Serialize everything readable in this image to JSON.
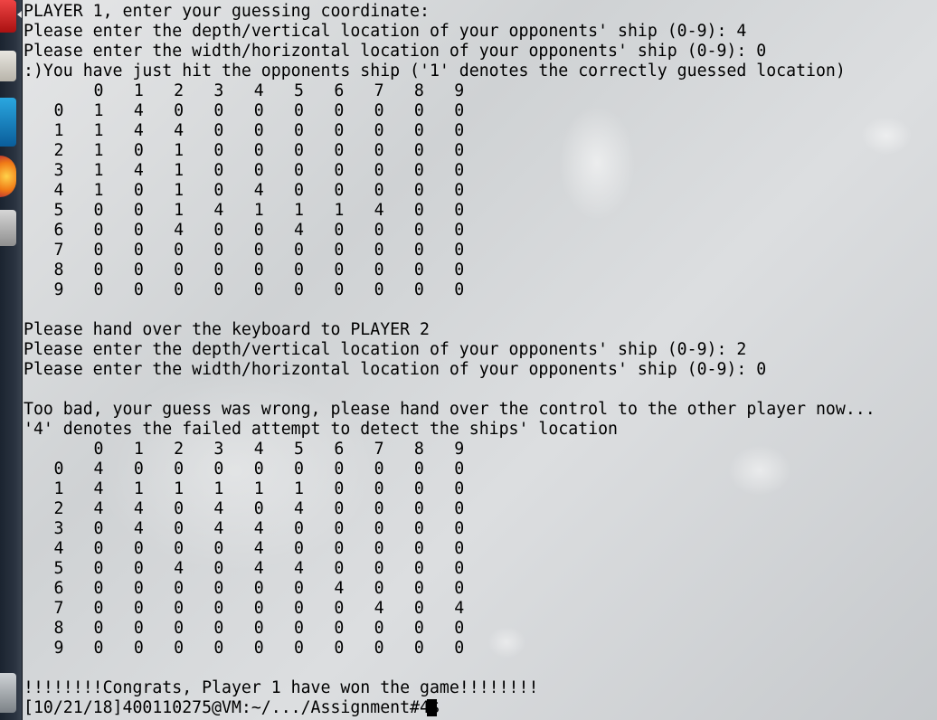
{
  "terminal": {
    "header_lines": [
      "PLAYER 1, enter your guessing coordinate:",
      "Please enter the depth/vertical location of your opponents' ship (0-9): 4",
      "Please enter the width/horizontal location of your opponents' ship (0-9): 0",
      ":)You have just hit the opponents ship ('1' denotes the correctly guessed location)"
    ],
    "grid1": {
      "col_headers": [
        "0",
        "1",
        "2",
        "3",
        "4",
        "5",
        "6",
        "7",
        "8",
        "9"
      ],
      "rows": [
        {
          "label": "0",
          "cells": [
            "1",
            "4",
            "0",
            "0",
            "0",
            "0",
            "0",
            "0",
            "0",
            "0"
          ]
        },
        {
          "label": "1",
          "cells": [
            "1",
            "4",
            "4",
            "0",
            "0",
            "0",
            "0",
            "0",
            "0",
            "0"
          ]
        },
        {
          "label": "2",
          "cells": [
            "1",
            "0",
            "1",
            "0",
            "0",
            "0",
            "0",
            "0",
            "0",
            "0"
          ]
        },
        {
          "label": "3",
          "cells": [
            "1",
            "4",
            "1",
            "0",
            "0",
            "0",
            "0",
            "0",
            "0",
            "0"
          ]
        },
        {
          "label": "4",
          "cells": [
            "1",
            "0",
            "1",
            "0",
            "4",
            "0",
            "0",
            "0",
            "0",
            "0"
          ]
        },
        {
          "label": "5",
          "cells": [
            "0",
            "0",
            "1",
            "4",
            "1",
            "1",
            "1",
            "4",
            "0",
            "0"
          ]
        },
        {
          "label": "6",
          "cells": [
            "0",
            "0",
            "4",
            "0",
            "0",
            "4",
            "0",
            "0",
            "0",
            "0"
          ]
        },
        {
          "label": "7",
          "cells": [
            "0",
            "0",
            "0",
            "0",
            "0",
            "0",
            "0",
            "0",
            "0",
            "0"
          ]
        },
        {
          "label": "8",
          "cells": [
            "0",
            "0",
            "0",
            "0",
            "0",
            "0",
            "0",
            "0",
            "0",
            "0"
          ]
        },
        {
          "label": "9",
          "cells": [
            "0",
            "0",
            "0",
            "0",
            "0",
            "0",
            "0",
            "0",
            "0",
            "0"
          ]
        }
      ]
    },
    "middle_lines": [
      "Please hand over the keyboard to PLAYER 2",
      "Please enter the depth/vertical location of your opponents' ship (0-9): 2",
      "Please enter the width/horizontal location of your opponents' ship (0-9): 0"
    ],
    "fail_lines": [
      "Too bad, your guess was wrong, please hand over the control to the other player now...",
      "'4' denotes the failed attempt to detect the ships' location"
    ],
    "grid2": {
      "col_headers": [
        "0",
        "1",
        "2",
        "3",
        "4",
        "5",
        "6",
        "7",
        "8",
        "9"
      ],
      "rows": [
        {
          "label": "0",
          "cells": [
            "4",
            "0",
            "0",
            "0",
            "0",
            "0",
            "0",
            "0",
            "0",
            "0"
          ]
        },
        {
          "label": "1",
          "cells": [
            "4",
            "1",
            "1",
            "1",
            "1",
            "1",
            "0",
            "0",
            "0",
            "0"
          ]
        },
        {
          "label": "2",
          "cells": [
            "4",
            "4",
            "0",
            "4",
            "0",
            "4",
            "0",
            "0",
            "0",
            "0"
          ]
        },
        {
          "label": "3",
          "cells": [
            "0",
            "4",
            "0",
            "4",
            "4",
            "0",
            "0",
            "0",
            "0",
            "0"
          ]
        },
        {
          "label": "4",
          "cells": [
            "0",
            "0",
            "0",
            "0",
            "4",
            "0",
            "0",
            "0",
            "0",
            "0"
          ]
        },
        {
          "label": "5",
          "cells": [
            "0",
            "0",
            "4",
            "0",
            "4",
            "4",
            "0",
            "0",
            "0",
            "0"
          ]
        },
        {
          "label": "6",
          "cells": [
            "0",
            "0",
            "0",
            "0",
            "0",
            "0",
            "4",
            "0",
            "0",
            "0"
          ]
        },
        {
          "label": "7",
          "cells": [
            "0",
            "0",
            "0",
            "0",
            "0",
            "0",
            "0",
            "4",
            "0",
            "4"
          ]
        },
        {
          "label": "8",
          "cells": [
            "0",
            "0",
            "0",
            "0",
            "0",
            "0",
            "0",
            "0",
            "0",
            "0"
          ]
        },
        {
          "label": "9",
          "cells": [
            "0",
            "0",
            "0",
            "0",
            "0",
            "0",
            "0",
            "0",
            "0",
            "0"
          ]
        }
      ]
    },
    "win_line": "!!!!!!!!Congrats, Player 1 have won the game!!!!!!!!",
    "prompt": "[10/21/18]400110275@VM:~/.../Assignment#4$ "
  },
  "launcher": {
    "icons": [
      "app-icon",
      "files-icon",
      "terminal-icon",
      "firefox-icon",
      "settings-icon",
      "trash-icon"
    ]
  }
}
